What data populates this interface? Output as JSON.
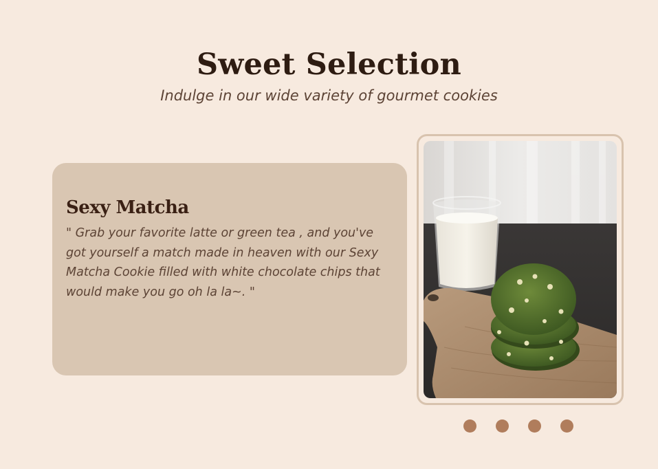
{
  "header": {
    "title": "Sweet Selection",
    "subtitle": "Indulge in our wide variety of gourmet cookies"
  },
  "feature": {
    "name": "Sexy Matcha",
    "description": "\" Grab your favorite latte or green tea , and you've got yourself a match made in heaven with our Sexy Matcha Cookie filled with white chocolate chips that would make you go oh la la~. \"",
    "image_icon": "matcha-cookie-photo"
  },
  "carousel": {
    "slide_count": 4
  },
  "colors": {
    "background": "#f7eadf",
    "card": "#d9c6b2",
    "dot": "#b07d5c",
    "title": "#2e1c12"
  }
}
